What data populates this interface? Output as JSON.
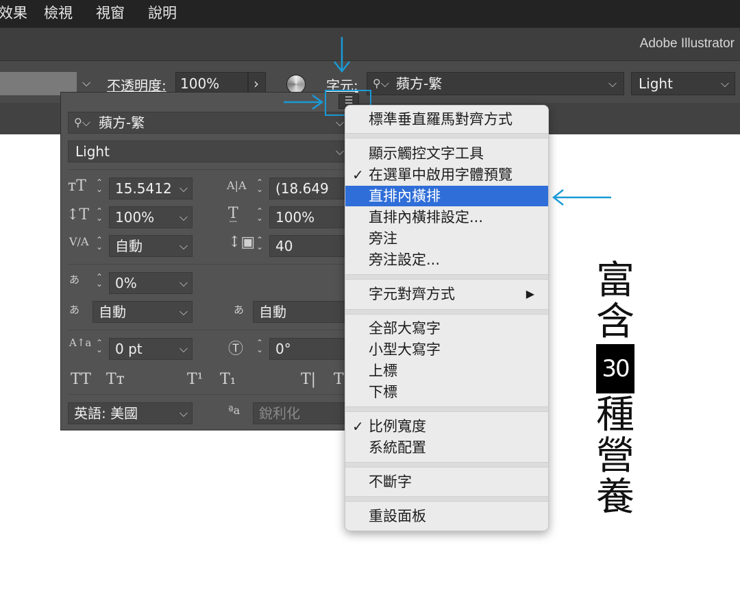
{
  "menubar": {
    "items": [
      "效果",
      "檢視",
      "視窗",
      "說明"
    ]
  },
  "app": {
    "title": "Adobe Illustrator"
  },
  "controlbar": {
    "opacity_label": "不透明度:",
    "opacity_value": "100%",
    "char_label": "字元:",
    "font_family": "蘋方-繁",
    "font_style": "Light"
  },
  "panel": {
    "font_family": "蘋方-繁",
    "font_style": "Light",
    "font_size": "15.5412",
    "leading": "(18.649",
    "vertical_scale": "100%",
    "horizontal_scale": "100%",
    "kerning": "自動",
    "tracking": "40",
    "tsume": "0%",
    "aki_left": "自動",
    "aki_right": "自動",
    "baseline_shift": "0 pt",
    "rotation": "0°",
    "language": "英語: 美國",
    "antialias": "銳利化"
  },
  "flyout": {
    "items": [
      {
        "label": "標準垂直羅馬對齊方式",
        "checked": false
      },
      {
        "label": "顯示觸控文字工具",
        "checked": false
      },
      {
        "label": "在選單中啟用字體預覽",
        "checked": true
      },
      {
        "label": "直排內橫排",
        "checked": false,
        "highlighted": true
      },
      {
        "label": "直排內橫排設定...",
        "checked": false
      },
      {
        "label": "旁注",
        "checked": false
      },
      {
        "label": "旁注設定...",
        "checked": false
      },
      {
        "label": "字元對齊方式",
        "checked": false,
        "submenu": true
      },
      {
        "label": "全部大寫字",
        "checked": false
      },
      {
        "label": "小型大寫字",
        "checked": false
      },
      {
        "label": "上標",
        "checked": false
      },
      {
        "label": "下標",
        "checked": false
      },
      {
        "label": "比例寬度",
        "checked": true
      },
      {
        "label": "系統配置",
        "checked": false
      },
      {
        "label": "不斷字",
        "checked": false
      },
      {
        "label": "重設面板",
        "checked": false
      }
    ],
    "check_glyph": "✓",
    "submenu_glyph": "▶"
  },
  "canvas": {
    "vertical_text_before": "富含",
    "tcy_text": "30",
    "vertical_text_after": "種營養"
  },
  "colors": {
    "accent": "#1a9ad6",
    "highlight": "#2f6ed8"
  },
  "icons": [
    "search-icon",
    "chevron-down-icon",
    "menu-list-icon",
    "color-wheel-icon",
    "checkmark-icon",
    "submenu-arrow-icon"
  ]
}
